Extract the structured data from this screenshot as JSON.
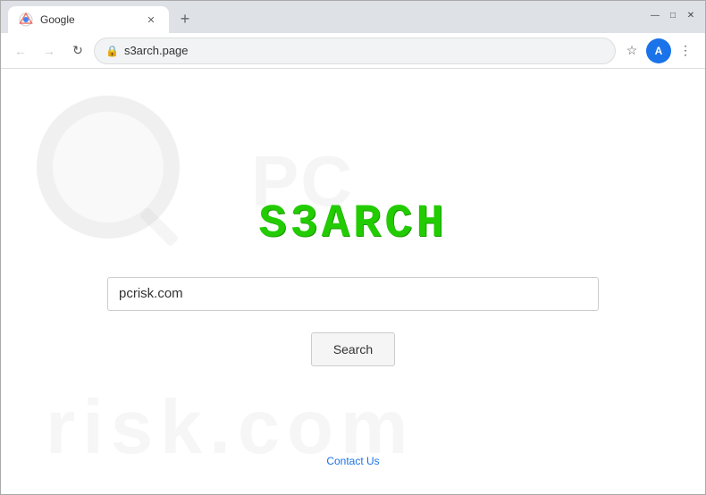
{
  "window": {
    "title": "Google",
    "url": "s3arch.page",
    "tab_label": "Google"
  },
  "nav": {
    "back_icon": "←",
    "forward_icon": "→",
    "refresh_icon": "↻",
    "lock_icon": "🔒",
    "star_icon": "☆",
    "account_initial": "A",
    "menu_icon": "⋮"
  },
  "logo": {
    "text": "S3ARCH"
  },
  "search": {
    "input_value": "pcrisk.com",
    "input_placeholder": "",
    "button_label": "Search"
  },
  "footer": {
    "contact_label": "Contact Us"
  },
  "window_controls": {
    "minimize": "—",
    "maximize": "□",
    "close": "✕"
  }
}
